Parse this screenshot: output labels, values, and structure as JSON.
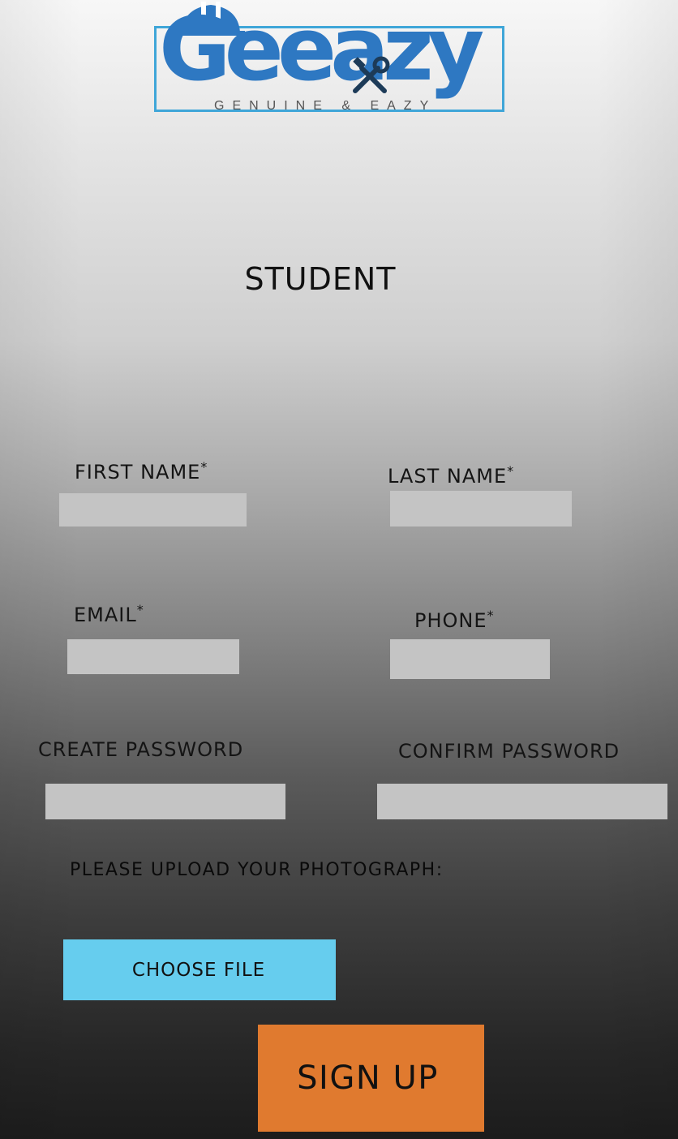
{
  "logo": {
    "wordmark": "Geeazy",
    "tagline": "GENUINE & EAZY",
    "colors": {
      "primary": "#2f86c9",
      "light": "#4db3e6"
    },
    "icons": [
      "helmet-icon",
      "tools-icon"
    ]
  },
  "form": {
    "title": "STUDENT",
    "first_name": {
      "label": "FIRST NAME",
      "required_mark": "*",
      "value": ""
    },
    "last_name": {
      "label": "LAST NAME",
      "required_mark": "*",
      "value": ""
    },
    "email": {
      "label": "EMAIL",
      "required_mark": "*",
      "value": ""
    },
    "phone": {
      "label": "PHONE",
      "required_mark": "*",
      "value": ""
    },
    "create_password": {
      "label": "CREATE PASSWORD",
      "value": ""
    },
    "confirm_password": {
      "label": "CONFIRM PASSWORD",
      "value": ""
    },
    "upload_label": "PLEASE UPLOAD YOUR PHOTOGRAPH:",
    "choose_file_label": "CHOOSE FILE",
    "signup_label": "SIGN UP"
  },
  "colors": {
    "field_bg": "#c4c4c4",
    "choose_file_bg": "#66cdee",
    "signup_bg": "#e07a2f"
  }
}
